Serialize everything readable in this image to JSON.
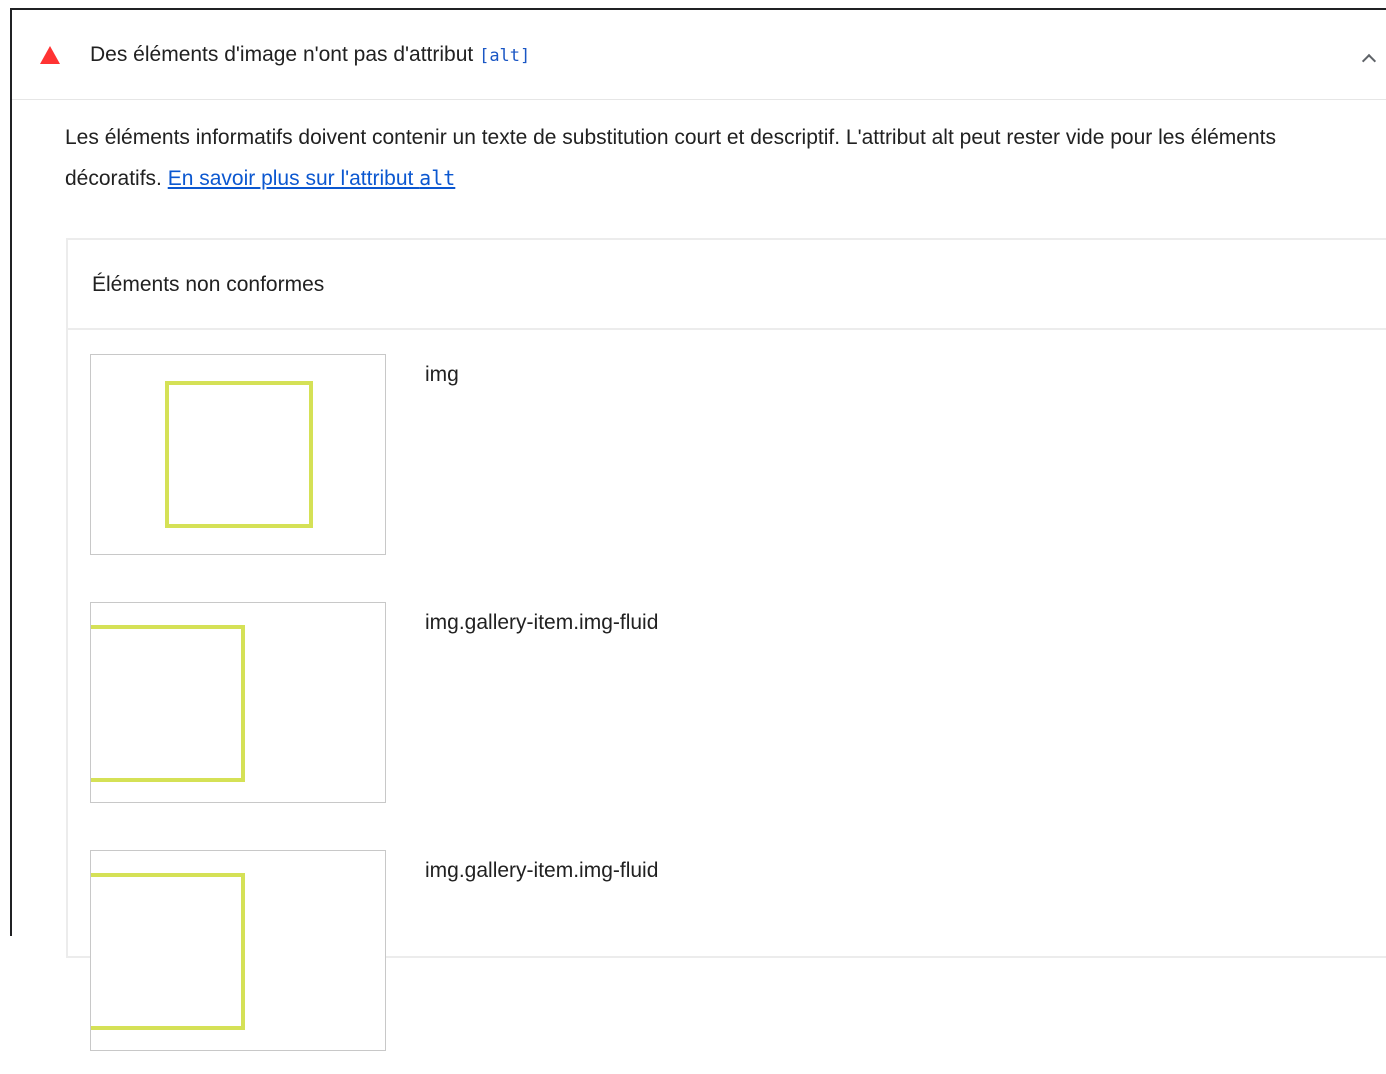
{
  "audit": {
    "title": "Des éléments d'image n'ont pas d'attribut ",
    "title_code": "[alt]",
    "description": "Les éléments informatifs doivent contenir un texte de substitution court et descriptif. L'attribut alt peut rester vide pour les éléments décoratifs. ",
    "learn_more_text": "En savoir plus sur l'attribut ",
    "learn_more_code": "alt"
  },
  "table": {
    "header": "Éléments non conformes",
    "rows": [
      {
        "label": "img"
      },
      {
        "label": "img.gallery-item.img-fluid"
      },
      {
        "label": "img.gallery-item.img-fluid"
      }
    ]
  },
  "colors": {
    "fail": "#ff3333",
    "link": "#0b57d0",
    "code": "#1a56c4",
    "highlight": "#d5e156"
  },
  "icons": {
    "status": "fail-triangle-icon",
    "toggle": "chevron-up-icon"
  }
}
